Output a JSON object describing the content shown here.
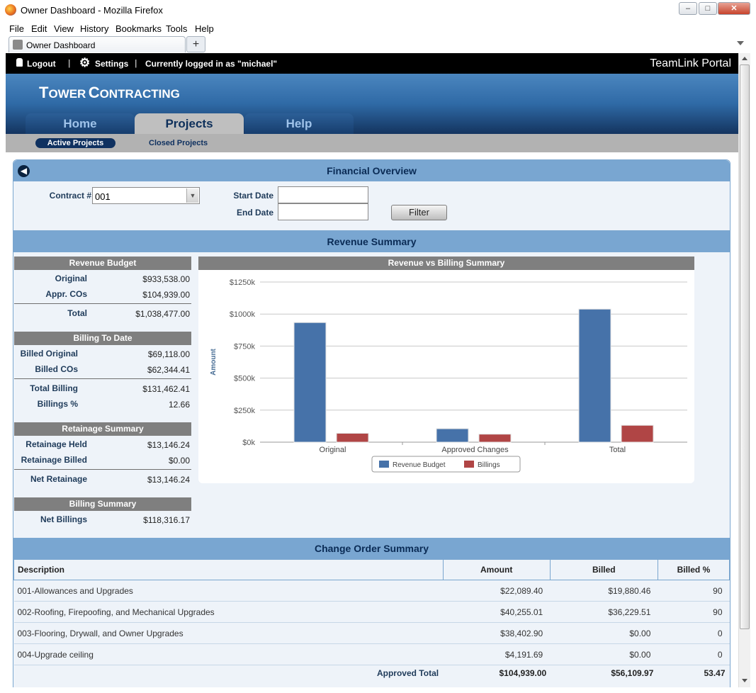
{
  "window": {
    "title": "Owner Dashboard - Mozilla Firefox"
  },
  "menu": [
    "File",
    "Edit",
    "View",
    "History",
    "Bookmarks",
    "Tools",
    "Help"
  ],
  "browser_tab": {
    "label": "Owner Dashboard",
    "new_tab": "+"
  },
  "topbar": {
    "logout": "Logout",
    "settings": "Settings",
    "logged_in": "Currently logged in as \"michael\"",
    "portal": "TeamLink Portal"
  },
  "brand": {
    "first_big": "T",
    "first_small": "OWER",
    "second_big": "C",
    "second_small": "ONTRACTING"
  },
  "nav": {
    "tabs": [
      "Home",
      "Projects",
      "Help"
    ],
    "active": "Projects"
  },
  "subnav": {
    "active": "Active Projects",
    "other": "Closed Projects"
  },
  "financial": {
    "title": "Financial Overview",
    "contract_label": "Contract #",
    "contract_value": "001",
    "start_label": "Start Date",
    "start_value": "",
    "end_label": "End Date",
    "end_value": "",
    "filter_button": "Filter"
  },
  "revenue_summary": {
    "title": "Revenue Summary",
    "revenue_budget": {
      "header": "Revenue Budget",
      "original_label": "Original",
      "original": "$933,538.00",
      "cos_label": "Appr. COs",
      "cos": "$104,939.00",
      "total_label": "Total",
      "total": "$1,038,477.00"
    },
    "billing_to_date": {
      "header": "Billing To Date",
      "billed_original_label": "Billed Original",
      "billed_original": "$69,118.00",
      "billed_cos_label": "Billed COs",
      "billed_cos": "$62,344.41",
      "total_label": "Total Billing",
      "total": "$131,462.41",
      "pct_label": "Billings %",
      "pct": "12.66"
    },
    "retainage": {
      "header": "Retainage Summary",
      "held_label": "Retainage Held",
      "held": "$13,146.24",
      "billed_label": "Retainage Billed",
      "billed": "$0.00",
      "net_label": "Net Retainage",
      "net": "$13,146.24"
    },
    "billing_summary": {
      "header": "Billing Summary",
      "net_label": "Net Billings",
      "net": "$118,316.17"
    }
  },
  "chart_data": {
    "type": "bar",
    "title": "Revenue vs Billing Summary",
    "xlabel": "",
    "ylabel": "Amount",
    "categories": [
      "Original",
      "Approved Changes",
      "Total"
    ],
    "series": [
      {
        "name": "Revenue Budget",
        "values": [
          933538,
          104939,
          1038477
        ],
        "color": "#4672a9"
      },
      {
        "name": "Billings",
        "values": [
          69118,
          62344.41,
          131462.41
        ],
        "color": "#b04545"
      }
    ],
    "ylim": [
      0,
      1250000
    ],
    "yticks": [
      0,
      250000,
      500000,
      750000,
      1000000,
      1250000
    ],
    "ytick_labels": [
      "$0k",
      "$250k",
      "$500k",
      "$750k",
      "$1000k",
      "$1250k"
    ],
    "grid": true,
    "legend": "bottom"
  },
  "change_orders": {
    "title": "Change Order Summary",
    "columns": [
      "Description",
      "Amount",
      "Billed",
      "Billed %"
    ],
    "rows": [
      [
        "001-Allowances and Upgrades",
        "$22,089.40",
        "$19,880.46",
        "90"
      ],
      [
        "002-Roofing, Firepoofing, and Mechanical Upgrades",
        "$40,255.01",
        "$36,229.51",
        "90"
      ],
      [
        "003-Flooring, Drywall, and Owner Upgrades",
        "$38,402.90",
        "$0.00",
        "0"
      ],
      [
        "004-Upgrade ceiling",
        "$4,191.69",
        "$0.00",
        "0"
      ]
    ],
    "total": {
      "label": "Approved Total",
      "amount": "$104,939.00",
      "billed": "$56,109.97",
      "pct": "53.47"
    }
  }
}
